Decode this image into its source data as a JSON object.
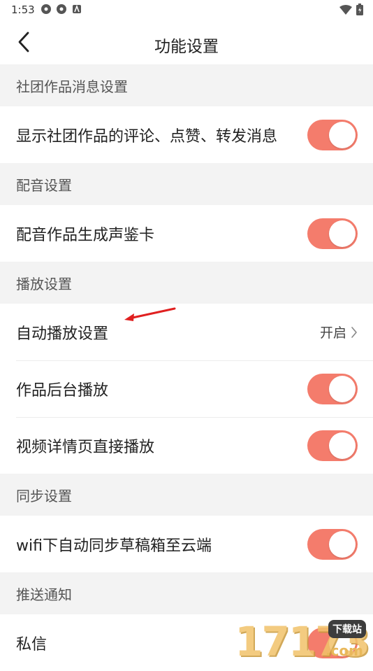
{
  "status_bar": {
    "time": "1:53",
    "icons_left": [
      "app-notification-icon",
      "app-notification-icon",
      "a-notification-icon"
    ],
    "icons_right": [
      "wifi-icon",
      "battery-icon"
    ]
  },
  "app_bar": {
    "back_icon": "back-arrow-icon",
    "title": "功能设置"
  },
  "sections": [
    {
      "header": "社团作品消息设置",
      "rows": [
        {
          "label": "显示社团作品的评论、点赞、转发消息",
          "control": "toggle",
          "on": true
        }
      ]
    },
    {
      "header": "配音设置",
      "rows": [
        {
          "label": "配音作品生成声鉴卡",
          "control": "toggle",
          "on": true
        }
      ]
    },
    {
      "header": "播放设置",
      "rows": [
        {
          "label": "自动播放设置",
          "control": "link",
          "value": "开启"
        },
        {
          "label": "作品后台播放",
          "control": "toggle",
          "on": true
        },
        {
          "label": "视频详情页直接播放",
          "control": "toggle",
          "on": true
        }
      ]
    },
    {
      "header": "同步设置",
      "rows": [
        {
          "label": "wifi下自动同步草稿箱至云端",
          "control": "toggle",
          "on": true
        }
      ]
    },
    {
      "header": "推送通知",
      "rows": [
        {
          "label": "私信",
          "control": "toggle",
          "on": true
        }
      ]
    }
  ],
  "watermark": {
    "digits": "17173",
    "badge": "下载站",
    "suffix": ".com"
  },
  "colors": {
    "toggle_on": "#f47c6c",
    "annotation_arrow": "#e02020",
    "section_background": "#f3f3f3"
  }
}
